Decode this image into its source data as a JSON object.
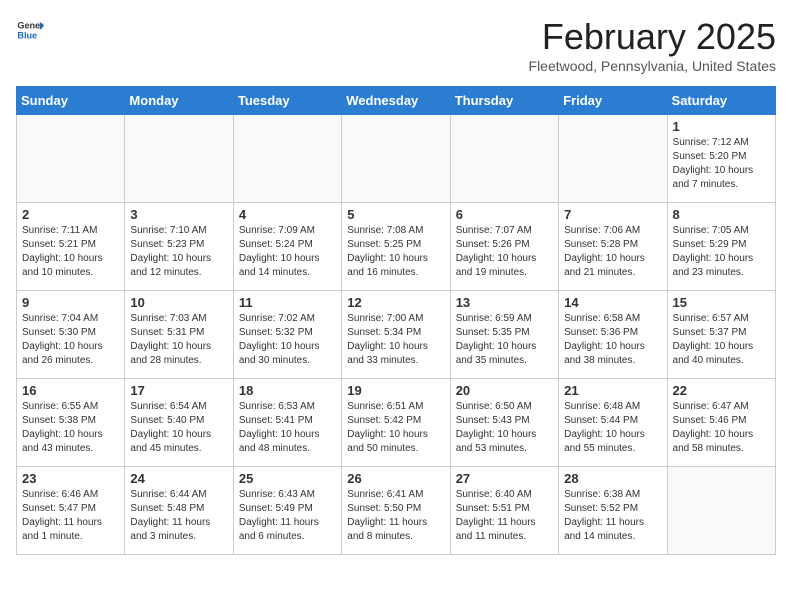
{
  "header": {
    "logo_general": "General",
    "logo_blue": "Blue",
    "calendar_title": "February 2025",
    "calendar_subtitle": "Fleetwood, Pennsylvania, United States"
  },
  "weekdays": [
    "Sunday",
    "Monday",
    "Tuesday",
    "Wednesday",
    "Thursday",
    "Friday",
    "Saturday"
  ],
  "weeks": [
    [
      {
        "day": "",
        "info": ""
      },
      {
        "day": "",
        "info": ""
      },
      {
        "day": "",
        "info": ""
      },
      {
        "day": "",
        "info": ""
      },
      {
        "day": "",
        "info": ""
      },
      {
        "day": "",
        "info": ""
      },
      {
        "day": "1",
        "info": "Sunrise: 7:12 AM\nSunset: 5:20 PM\nDaylight: 10 hours\nand 7 minutes."
      }
    ],
    [
      {
        "day": "2",
        "info": "Sunrise: 7:11 AM\nSunset: 5:21 PM\nDaylight: 10 hours\nand 10 minutes."
      },
      {
        "day": "3",
        "info": "Sunrise: 7:10 AM\nSunset: 5:23 PM\nDaylight: 10 hours\nand 12 minutes."
      },
      {
        "day": "4",
        "info": "Sunrise: 7:09 AM\nSunset: 5:24 PM\nDaylight: 10 hours\nand 14 minutes."
      },
      {
        "day": "5",
        "info": "Sunrise: 7:08 AM\nSunset: 5:25 PM\nDaylight: 10 hours\nand 16 minutes."
      },
      {
        "day": "6",
        "info": "Sunrise: 7:07 AM\nSunset: 5:26 PM\nDaylight: 10 hours\nand 19 minutes."
      },
      {
        "day": "7",
        "info": "Sunrise: 7:06 AM\nSunset: 5:28 PM\nDaylight: 10 hours\nand 21 minutes."
      },
      {
        "day": "8",
        "info": "Sunrise: 7:05 AM\nSunset: 5:29 PM\nDaylight: 10 hours\nand 23 minutes."
      }
    ],
    [
      {
        "day": "9",
        "info": "Sunrise: 7:04 AM\nSunset: 5:30 PM\nDaylight: 10 hours\nand 26 minutes."
      },
      {
        "day": "10",
        "info": "Sunrise: 7:03 AM\nSunset: 5:31 PM\nDaylight: 10 hours\nand 28 minutes."
      },
      {
        "day": "11",
        "info": "Sunrise: 7:02 AM\nSunset: 5:32 PM\nDaylight: 10 hours\nand 30 minutes."
      },
      {
        "day": "12",
        "info": "Sunrise: 7:00 AM\nSunset: 5:34 PM\nDaylight: 10 hours\nand 33 minutes."
      },
      {
        "day": "13",
        "info": "Sunrise: 6:59 AM\nSunset: 5:35 PM\nDaylight: 10 hours\nand 35 minutes."
      },
      {
        "day": "14",
        "info": "Sunrise: 6:58 AM\nSunset: 5:36 PM\nDaylight: 10 hours\nand 38 minutes."
      },
      {
        "day": "15",
        "info": "Sunrise: 6:57 AM\nSunset: 5:37 PM\nDaylight: 10 hours\nand 40 minutes."
      }
    ],
    [
      {
        "day": "16",
        "info": "Sunrise: 6:55 AM\nSunset: 5:38 PM\nDaylight: 10 hours\nand 43 minutes."
      },
      {
        "day": "17",
        "info": "Sunrise: 6:54 AM\nSunset: 5:40 PM\nDaylight: 10 hours\nand 45 minutes."
      },
      {
        "day": "18",
        "info": "Sunrise: 6:53 AM\nSunset: 5:41 PM\nDaylight: 10 hours\nand 48 minutes."
      },
      {
        "day": "19",
        "info": "Sunrise: 6:51 AM\nSunset: 5:42 PM\nDaylight: 10 hours\nand 50 minutes."
      },
      {
        "day": "20",
        "info": "Sunrise: 6:50 AM\nSunset: 5:43 PM\nDaylight: 10 hours\nand 53 minutes."
      },
      {
        "day": "21",
        "info": "Sunrise: 6:48 AM\nSunset: 5:44 PM\nDaylight: 10 hours\nand 55 minutes."
      },
      {
        "day": "22",
        "info": "Sunrise: 6:47 AM\nSunset: 5:46 PM\nDaylight: 10 hours\nand 58 minutes."
      }
    ],
    [
      {
        "day": "23",
        "info": "Sunrise: 6:46 AM\nSunset: 5:47 PM\nDaylight: 11 hours\nand 1 minute."
      },
      {
        "day": "24",
        "info": "Sunrise: 6:44 AM\nSunset: 5:48 PM\nDaylight: 11 hours\nand 3 minutes."
      },
      {
        "day": "25",
        "info": "Sunrise: 6:43 AM\nSunset: 5:49 PM\nDaylight: 11 hours\nand 6 minutes."
      },
      {
        "day": "26",
        "info": "Sunrise: 6:41 AM\nSunset: 5:50 PM\nDaylight: 11 hours\nand 8 minutes."
      },
      {
        "day": "27",
        "info": "Sunrise: 6:40 AM\nSunset: 5:51 PM\nDaylight: 11 hours\nand 11 minutes."
      },
      {
        "day": "28",
        "info": "Sunrise: 6:38 AM\nSunset: 5:52 PM\nDaylight: 11 hours\nand 14 minutes."
      },
      {
        "day": "",
        "info": ""
      }
    ]
  ]
}
